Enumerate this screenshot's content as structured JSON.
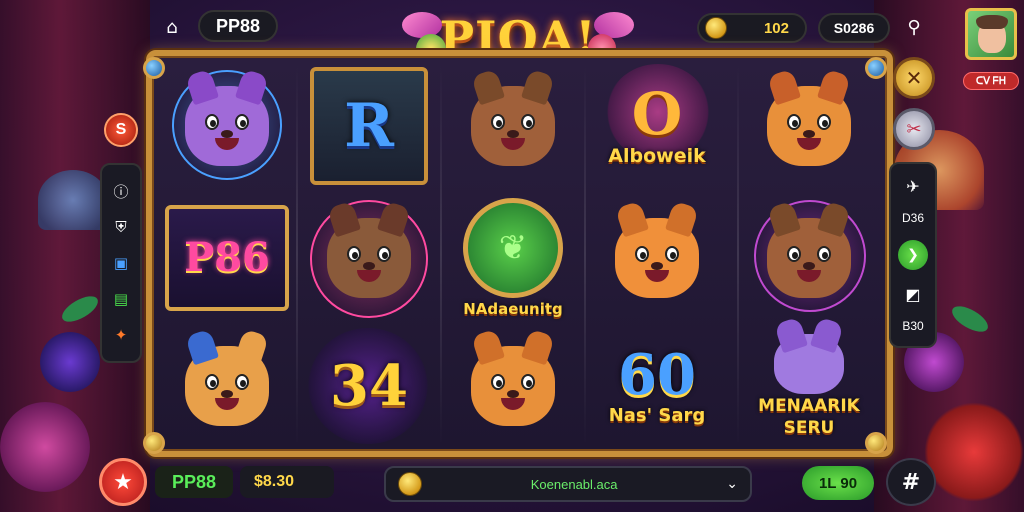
{
  "top": {
    "brand": "PP88",
    "logo": "PIOA!",
    "coins": "102",
    "score": "S0286",
    "avatar_badge": "ᑕᐯ ᖴᕼ"
  },
  "reels": {
    "labels": {
      "alboweik": "Alboweik",
      "nadaeunitg": "NAdaeunitg",
      "p86": "P86",
      "r_letter": "R",
      "n34": "34",
      "n60": "60",
      "nas_sarg": "Nas' Sarg",
      "menarik": "MENAARIK",
      "seru": "SERU"
    }
  },
  "left_panel": {
    "badge": "S"
  },
  "right_panel": {
    "value1": "D36",
    "value2": "B30"
  },
  "bottom": {
    "brand": "PP88",
    "bet": "$8.30",
    "select_text": "Koenenabl.aca",
    "win": "1L 90"
  },
  "colors": {
    "frame_gold": "#c8903a",
    "green_accent": "#5aee5a",
    "gold_text": "#ffd84a"
  },
  "icons": {
    "home": "home-icon",
    "share": "share-icon",
    "menu": "hash-menu-icon",
    "spin": "star-spin-icon"
  }
}
